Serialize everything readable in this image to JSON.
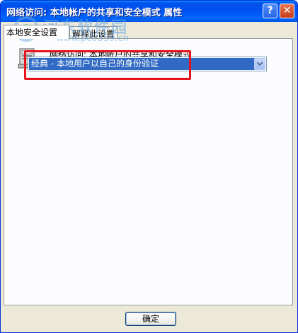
{
  "window": {
    "title": "网络访问: 本地帐户的共享和安全模式 属性",
    "help_glyph": "?",
    "close_glyph": "✕"
  },
  "watermark": {
    "site_name": "河东软件园",
    "url": "www.pc0359.cn"
  },
  "tabs": [
    {
      "label": "本地安全设置",
      "active": true
    },
    {
      "label": "解释此设置",
      "active": false
    }
  ],
  "panel": {
    "policy_name": "网络访问: 本地帐户的共享和安全模式",
    "icon": "policy-computer-icon"
  },
  "combo": {
    "selected": "经典 - 本地用户以自己的身份验证",
    "highlight_color": "#e8121c",
    "selection_color": "#316ac5"
  },
  "buttons": {
    "ok_label": "确定"
  }
}
